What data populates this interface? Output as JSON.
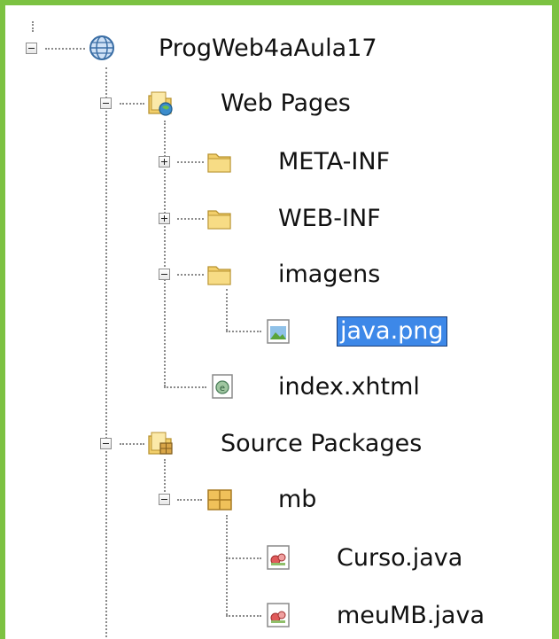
{
  "tree": {
    "project": {
      "label": "ProgWeb4aAula17",
      "icon": "project-globe-icon",
      "expanded": true
    },
    "web_pages": {
      "label": "Web Pages",
      "icon": "web-pages-folder-icon",
      "expanded": true,
      "children": [
        {
          "label": "META-INF",
          "icon": "folder-icon",
          "expanded": false
        },
        {
          "label": "WEB-INF",
          "icon": "folder-icon",
          "expanded": false
        },
        {
          "label": "imagens",
          "icon": "folder-icon",
          "expanded": true,
          "children": [
            {
              "label": "java.png",
              "icon": "image-file-icon",
              "selected": true
            }
          ]
        },
        {
          "label": "index.xhtml",
          "icon": "xhtml-file-icon"
        }
      ]
    },
    "source_packages": {
      "label": "Source Packages",
      "icon": "source-packages-folder-icon",
      "expanded": true,
      "children": [
        {
          "label": "mb",
          "icon": "package-icon",
          "expanded": true,
          "children": [
            {
              "label": "Curso.java",
              "icon": "java-class-icon"
            },
            {
              "label": "meuMB.java",
              "icon": "java-class-icon"
            }
          ]
        }
      ]
    }
  },
  "colors": {
    "frame_border": "#7cc242",
    "selection_background": "#3d88e8",
    "selection_text": "#ffffff",
    "text": "#111111",
    "guide_lines": "#8a8a8a"
  }
}
